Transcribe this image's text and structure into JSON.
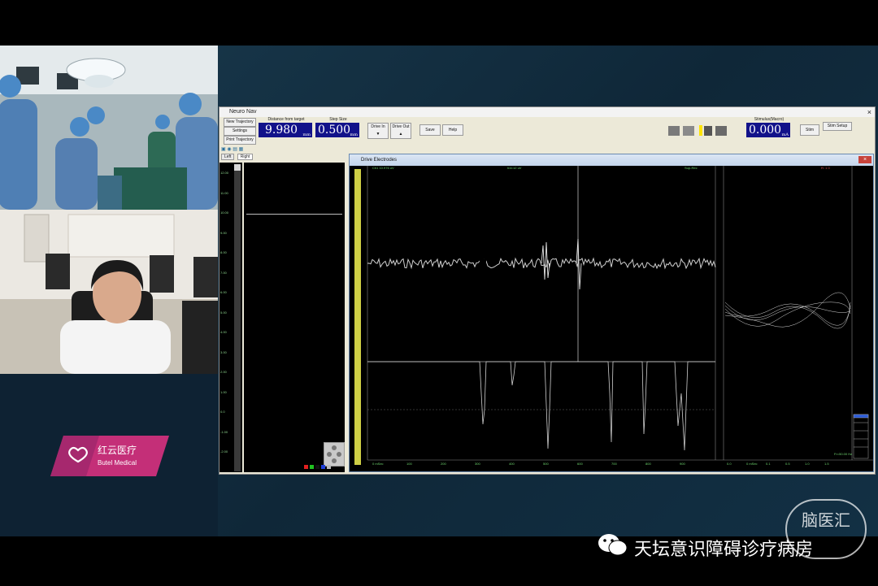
{
  "watermark": {
    "text": "天坛意识障碍诊疗病房",
    "icon": "wechat-icon",
    "logo_text": "脑医汇"
  },
  "brand": {
    "name_cn": "红云医疗",
    "name_en": "Butel Medical",
    "accent": "#c42f78"
  },
  "window": {
    "title": "Neuro Nav",
    "close": "×",
    "buttons": {
      "new_trajectory": "New Trajectory",
      "settings": "Settings",
      "print_trajectory": "Print Trajectory",
      "drive_in": "Drive In",
      "drive_out": "Drive Out",
      "save": "Save",
      "help": "Help",
      "stim": "Stim",
      "stim_setup": "Stim Setup"
    },
    "distance": {
      "label": "Distance from target",
      "value": "9.980",
      "unit": "mm"
    },
    "step": {
      "label": "Step Size",
      "value": "0.500",
      "unit": "mm"
    },
    "stimulus": {
      "label": "Stimulus(Macro)",
      "value": "0.000",
      "unit": "mA"
    },
    "tabs": [
      "Left",
      "Right"
    ]
  },
  "left_scale": [
    "12.00",
    "11.00",
    "10.00",
    "9.00",
    "8.00",
    "7.00",
    "6.00",
    "5.00",
    "4.00",
    "3.00",
    "2.00",
    "1.00",
    "0.0",
    "-1.00",
    "-2.00"
  ],
  "drive": {
    "title": "Drive Electrodes",
    "close": "×",
    "trace_label": "Ch1 10.976 uV",
    "mid_label": "Ird=12 uV",
    "right_label": "Sup-Rec",
    "red_label": "R: 1 0",
    "bottom_label": "Fr=50.00 Hz",
    "x_ticks": [
      "0 mSec",
      "100",
      "200",
      "300",
      "400",
      "500",
      "600",
      "700",
      "800",
      "900"
    ],
    "right_x_ticks": [
      "0.0",
      "0 mSec",
      "0.1",
      "0.5",
      "1.0",
      "1.5"
    ]
  },
  "colors": {
    "toolbar_bg": "#ece9d8",
    "display_blue": "#12128a",
    "trace": "#cfcfcf",
    "scale_text": "#8fd68f"
  }
}
